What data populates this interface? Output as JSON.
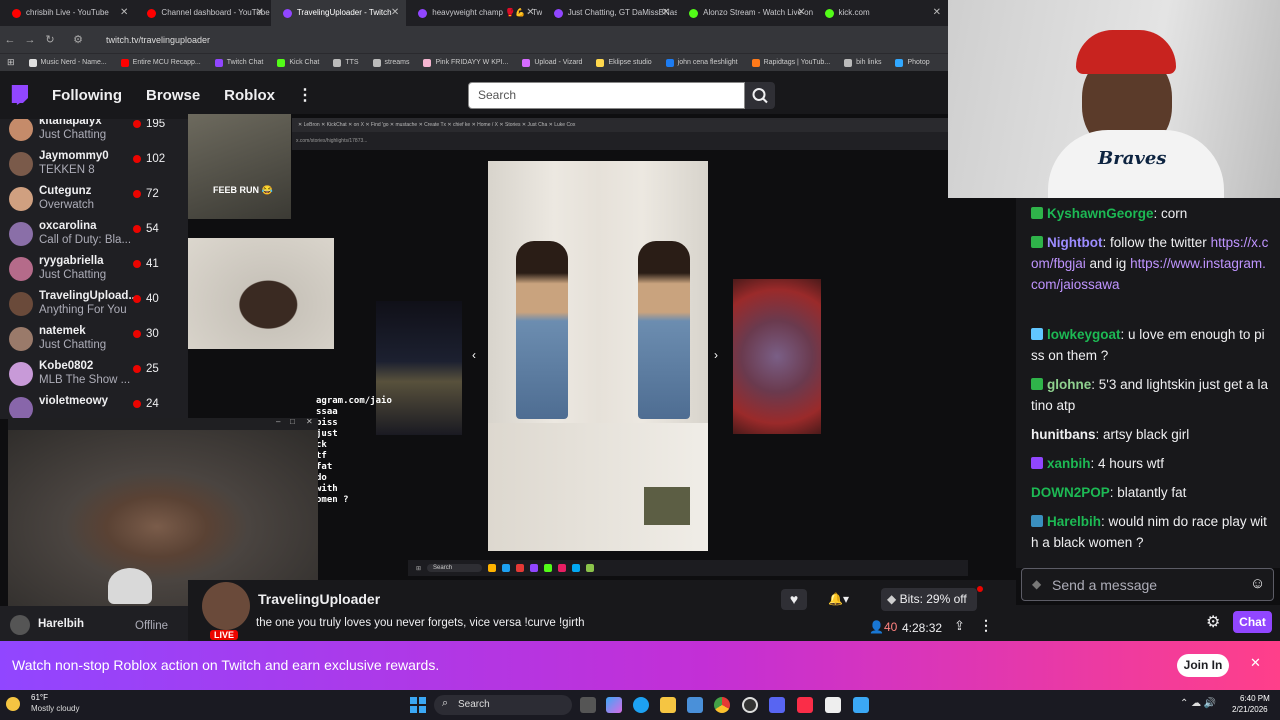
{
  "browser": {
    "tabs": [
      {
        "title": "chrisbih Live - YouTube",
        "color": "#ff0000"
      },
      {
        "title": "Channel dashboard - YouTube",
        "color": "#ff0000"
      },
      {
        "title": "TravelingUploader - Twitch",
        "color": "#9146ff",
        "active": true
      },
      {
        "title": "heavyweight champ 🥊💪 - Tw",
        "color": "#9146ff"
      },
      {
        "title": "Just Chatting, GT DaMissBNasty",
        "color": "#9146ff"
      },
      {
        "title": "Alonzo Stream - Watch Live on",
        "color": "#53fc18"
      },
      {
        "title": "kick.com",
        "color": "#53fc18"
      }
    ],
    "url": "twitch.tv/travelinguploader",
    "bookmarks": [
      {
        "label": "Music Nerd - Name...",
        "color": "#e0e0e0"
      },
      {
        "label": "Entire MCU Recapp...",
        "color": "#ff0000"
      },
      {
        "label": "Twitch Chat",
        "color": "#9146ff"
      },
      {
        "label": "Kick Chat",
        "color": "#53fc18"
      },
      {
        "label": "TTS",
        "color": "#bbbbbb"
      },
      {
        "label": "streams",
        "color": "#bbbbbb"
      },
      {
        "label": "Pink FRIDAYY W KPI...",
        "color": "#f5b5d0"
      },
      {
        "label": "Upload - Vizard",
        "color": "#d66bff"
      },
      {
        "label": "Eklipse studio",
        "color": "#ffd84d"
      },
      {
        "label": "john cena fleshlight",
        "color": "#1d7cf2"
      },
      {
        "label": "Rapidtags | YouTub...",
        "color": "#ff7a1a"
      },
      {
        "label": "bih links",
        "color": "#bbbbbb"
      },
      {
        "label": "Photop",
        "color": "#31a8ff"
      }
    ]
  },
  "topnav": {
    "following": "Following",
    "browse": "Browse",
    "roblox": "Roblox",
    "more": "⋮",
    "search_placeholder": "Search"
  },
  "sidebar": {
    "items": [
      {
        "name": "kitanapalyx",
        "category": "Just Chatting",
        "viewers": "195",
        "avatar": "#c58b6a"
      },
      {
        "name": "Jaymommy0",
        "category": "TEKKEN 8",
        "viewers": "102",
        "avatar": "#7a5a4a"
      },
      {
        "name": "Cutegunz",
        "category": "Overwatch",
        "viewers": "72",
        "avatar": "#d0a080"
      },
      {
        "name": "oxcarolina",
        "category": "Call of Duty: Bla...",
        "viewers": "54",
        "avatar": "#8a6fa8"
      },
      {
        "name": "ryygabriella",
        "category": "Just Chatting",
        "viewers": "41",
        "avatar": "#b56b8a"
      },
      {
        "name": "TravelingUpload...",
        "category": "Anything For You",
        "viewers": "40",
        "avatar": "#6a4a3a"
      },
      {
        "name": "natemek",
        "category": "Just Chatting",
        "viewers": "30",
        "avatar": "#9a7a6a"
      },
      {
        "name": "Kobe0802",
        "category": "MLB The Show ...",
        "viewers": "25",
        "avatar": "#c89ad8"
      },
      {
        "name": "violetmeowy",
        "category": "",
        "viewers": "24",
        "avatar": "#8866aa"
      }
    ],
    "bottom_user": "Harelbih",
    "bottom_status": "Offline"
  },
  "stream": {
    "overlay_text": "FEEB RUN 😂",
    "inner_url": "x.com/stories/highlights/17873...",
    "obs_chat_lines": [
      "agram.com/jaio",
      "ssaa",
      "piss",
      "just",
      "ck",
      "tf",
      "fat",
      "do",
      "with",
      "omen ?"
    ],
    "inner_task_search": "Search"
  },
  "channel": {
    "name": "TravelingUploader",
    "title": "the one you truly loves you never forgets, vice versa !curve !girth",
    "live": "LIVE",
    "viewers": "40",
    "uptime": "4:28:32",
    "bits": "Bits: 29% off"
  },
  "chat": {
    "messages": [
      {
        "user": "KyshawnGeorge",
        "color": "#1db954",
        "text": "corn",
        "badge": "#2fb34a"
      },
      {
        "user": "Nightbot",
        "color": "#9d8cff",
        "text": "follow the twitter",
        "link1": "https://x.com/fbgjai",
        "mid": " and ig ",
        "link2": "https://www.instagram.com/jaiossawa",
        "badge": "#2fb34a"
      },
      {
        "user": "lowkeygoat",
        "color": "#1db954",
        "text": "u love em enough to piss on them ?",
        "badge": "#61c6ff"
      },
      {
        "user": "glohne",
        "color": "#8fd18f",
        "text": "5'3 and lightskin just get a latino atp",
        "badge": "#2fb34a"
      },
      {
        "user": "hunitbans",
        "color": "#efeff1",
        "text": "artsy black girl",
        "badge": ""
      },
      {
        "user": "xanbih",
        "color": "#1db954",
        "text": "4 hours wtf",
        "badge": "#9146ff"
      },
      {
        "user": "DOWN2POP",
        "color": "#1db954",
        "text": "blatantly fat",
        "badge": ""
      },
      {
        "user": "Harelbih",
        "color": "#1db954",
        "text": "would nim do race play with a black women ?",
        "badge": "#3a8fbf"
      }
    ],
    "input_placeholder": "Send a message",
    "chat_button": "Chat"
  },
  "promo": {
    "text": "Watch non-stop Roblox action on Twitch and earn exclusive rewards.",
    "join": "Join In",
    "close": "✕"
  },
  "taskbar": {
    "weather_temp": "61°F",
    "weather_desc": "Mostly cloudy",
    "search": "Search",
    "time": "6:40 PM",
    "date": "2/21/2026"
  },
  "colors": {
    "twitch_purple": "#9146ff",
    "live_red": "#eb0400",
    "bg": "#0e0e10"
  }
}
